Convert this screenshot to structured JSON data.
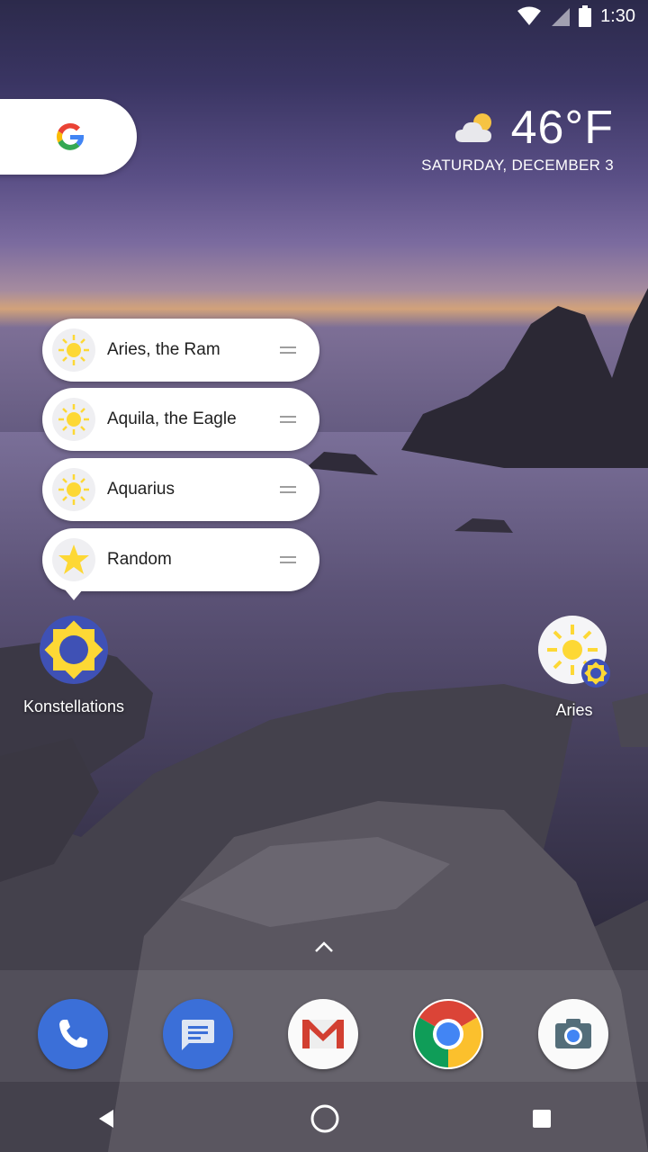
{
  "status_bar": {
    "time": "1:30"
  },
  "weather": {
    "temperature": "46°F",
    "date": "SATURDAY, DECEMBER 3",
    "icon": "partly-cloudy-icon"
  },
  "shortcuts": [
    {
      "label": "Aries, the Ram",
      "icon": "sun-icon"
    },
    {
      "label": "Aquila, the Eagle",
      "icon": "sun-icon"
    },
    {
      "label": "Aquarius",
      "icon": "sun-icon"
    },
    {
      "label": "Random",
      "icon": "star-icon"
    }
  ],
  "home_apps": {
    "konstellations": "Konstellations",
    "aries": "Aries"
  },
  "dock": [
    "Phone",
    "Messages",
    "Gmail",
    "Chrome",
    "Camera"
  ],
  "colors": {
    "konstellations_blue": "#3f51b5",
    "konstellations_yellow": "#fdd835",
    "phone_blue": "#3b6fd8",
    "messages_blue": "#3b6fd8"
  }
}
